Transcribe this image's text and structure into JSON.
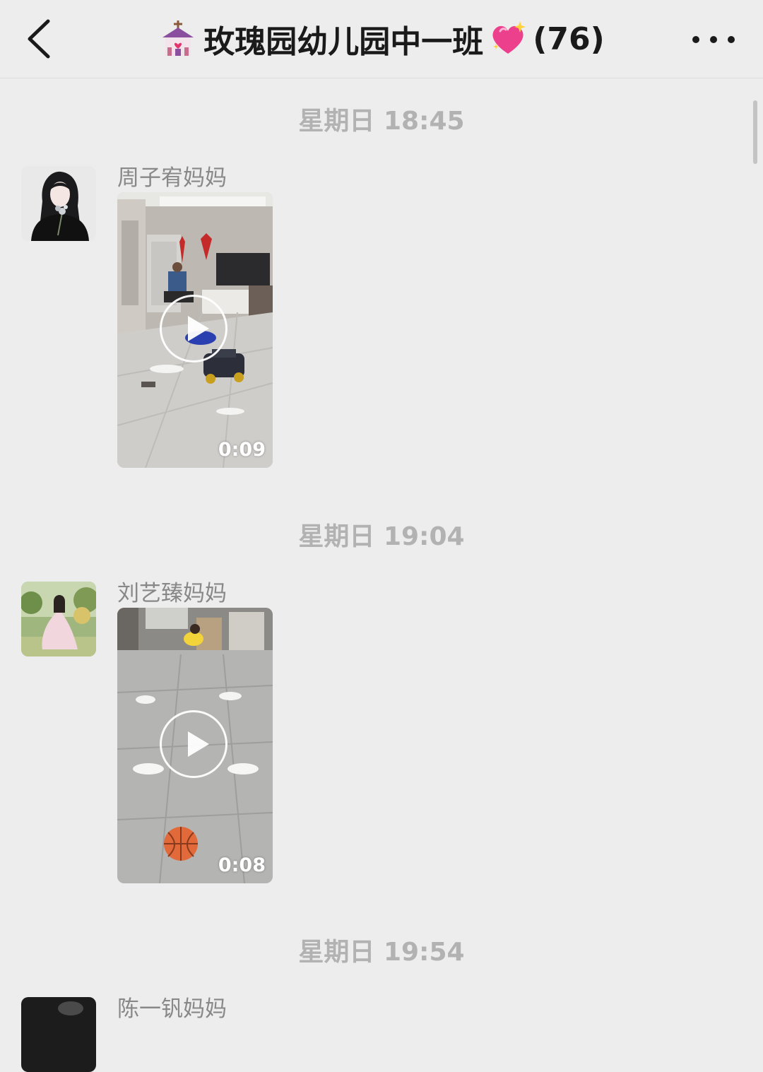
{
  "header": {
    "group_name": "玫瑰园幼儿园中一班",
    "member_count": "(76)",
    "back_icon": "chevron-left-icon",
    "more_icon": "more-dots-icon"
  },
  "messages": [
    {
      "timestamp": "星期日 18:45",
      "sender": "周子宥妈妈",
      "video_duration": "0:09"
    },
    {
      "timestamp": "星期日 19:04",
      "sender": "刘艺臻妈妈",
      "video_duration": "0:08"
    },
    {
      "timestamp": "星期日 19:54",
      "sender": "陈一钒妈妈"
    }
  ],
  "colors": {
    "background": "#ededed",
    "timestamp": "#b2b2b2",
    "sender": "#888888",
    "title": "#1a1a1a"
  }
}
